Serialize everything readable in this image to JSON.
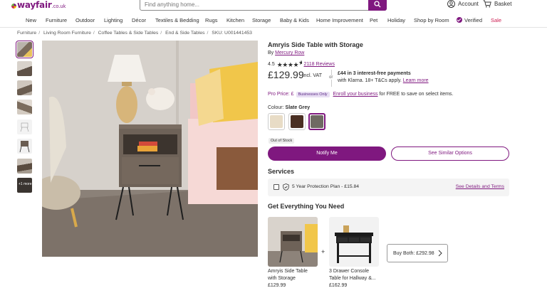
{
  "header": {
    "logo_text": "wayfair",
    "logo_suffix": ".co.uk",
    "search_placeholder": "Find anything home...",
    "account_label": "Account",
    "basket_label": "Basket",
    "brand_color": "#7f187f"
  },
  "nav": {
    "items": [
      "New",
      "Furniture",
      "Outdoor",
      "Lighting",
      "Décor",
      "Textiles & Bedding",
      "Rugs",
      "Kitchen",
      "Storage",
      "Baby & Kids",
      "Home Improvement",
      "Pet",
      "Holiday",
      "Shop by Room",
      "Verified",
      "Sale"
    ]
  },
  "breadcrumb": {
    "items": [
      "Furniture",
      "Living Room Furniture",
      "Coffee Tables & Side Tables",
      "End & Side Tables"
    ],
    "sku": "SKU: U001441453"
  },
  "gallery": {
    "more_label": "+1 more"
  },
  "product": {
    "title": "Amryis Side Table with Storage",
    "by_prefix": "By",
    "brand": "Mercury Row",
    "rating": "4.5",
    "reviews": "2118 Reviews",
    "price": "£129.99",
    "inc_vat": "incl. VAT",
    "or": "or",
    "klarna_line1": "£44 in 3 interest-free payments",
    "klarna_line2": "with Klarna. 18+ T&Cs apply.",
    "learn_more": "Learn more",
    "pro_label": "Pro Price: £",
    "pro_badge": "Businesses Only",
    "pro_link": "Enroll your business",
    "pro_suffix": "for FREE to save on select items.",
    "colour_label": "Colour:",
    "colour_value": "Slate Grey",
    "swatches": [
      "#e8dcc6",
      "#4a2f22",
      "#6f6a63"
    ],
    "stock_badge": "Out of Stock",
    "notify_button": "Notify Me",
    "similar_button": "See Similar Options"
  },
  "services": {
    "heading": "Services",
    "plan": "5 Year Protection Plan - £15.84",
    "terms": "See Details and Terms"
  },
  "bundle": {
    "heading": "Get Everything You Need",
    "plus": "+",
    "items": [
      {
        "name_line1": "Amryis Side Table",
        "name_line2": "with Storage",
        "price": "£129.99"
      },
      {
        "name_line1": "3 Drawer Console",
        "name_line2": "Table for Hallway &...",
        "price": "£162.99"
      }
    ],
    "buy_both": "Buy Both: £292.98"
  }
}
